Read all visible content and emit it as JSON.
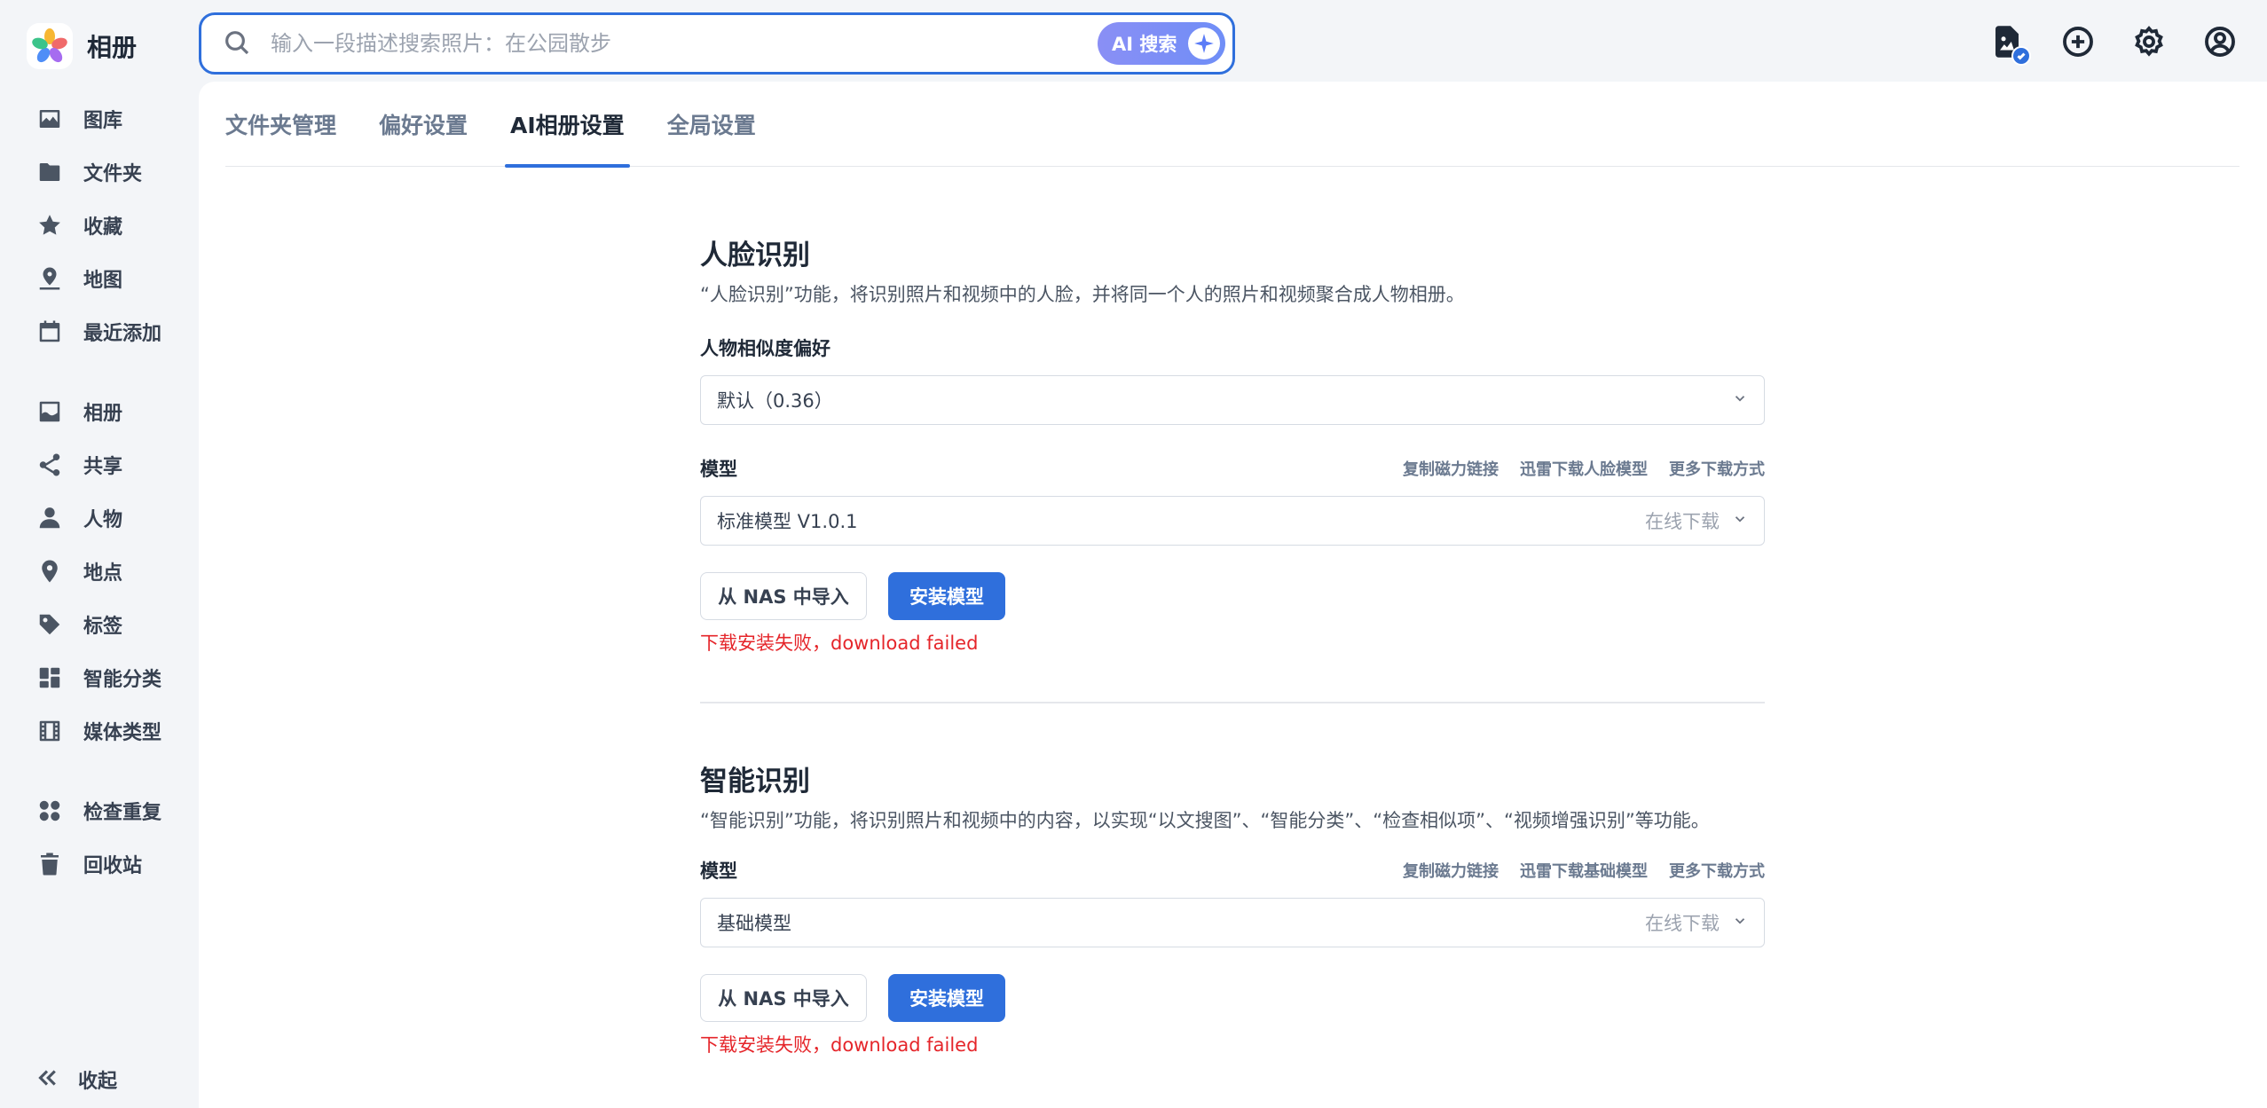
{
  "app": {
    "name": "相册"
  },
  "search": {
    "placeholder": "输入一段描述搜索照片：在公园散步",
    "ai_label": "AI 搜索"
  },
  "sidebar": {
    "group1": [
      {
        "label": "图库",
        "icon": "image-icon"
      },
      {
        "label": "文件夹",
        "icon": "folder-icon"
      },
      {
        "label": "收藏",
        "icon": "star-icon"
      },
      {
        "label": "地图",
        "icon": "map-icon"
      },
      {
        "label": "最近添加",
        "icon": "calendar-icon"
      }
    ],
    "group2": [
      {
        "label": "相册",
        "icon": "album-icon"
      },
      {
        "label": "共享",
        "icon": "share-icon"
      },
      {
        "label": "人物",
        "icon": "person-icon"
      },
      {
        "label": "地点",
        "icon": "location-icon"
      },
      {
        "label": "标签",
        "icon": "tag-icon"
      },
      {
        "label": "智能分类",
        "icon": "grid-icon"
      },
      {
        "label": "媒体类型",
        "icon": "film-icon"
      }
    ],
    "group3": [
      {
        "label": "检查重复",
        "icon": "duplicate-icon"
      },
      {
        "label": "回收站",
        "icon": "trash-icon"
      }
    ],
    "collapse_label": "收起"
  },
  "tabs": [
    {
      "label": "文件夹管理",
      "active": false
    },
    {
      "label": "偏好设置",
      "active": false
    },
    {
      "label": "AI相册设置",
      "active": true
    },
    {
      "label": "全局设置",
      "active": false
    }
  ],
  "face": {
    "title": "人脸识别",
    "desc": "“人脸识别”功能，将识别照片和视频中的人脸，并将同一个人的照片和视频聚合成人物相册。",
    "similarity_label": "人物相似度偏好",
    "similarity_value": "默认（0.36）",
    "model_label": "模型",
    "links": [
      "复制磁力链接",
      "迅雷下载人脸模型",
      "更多下载方式"
    ],
    "model_value": "标准模型 V1.0.1",
    "model_hint": "在线下载",
    "import_label": "从 NAS 中导入",
    "install_label": "安装模型",
    "error": "下载安装失败，download failed"
  },
  "smart": {
    "title": "智能识别",
    "desc": "“智能识别”功能，将识别照片和视频中的内容，以实现“以文搜图”、“智能分类”、“检查相似项”、“视频增强识别”等功能。",
    "model_label": "模型",
    "links": [
      "复制磁力链接",
      "迅雷下载基础模型",
      "更多下载方式"
    ],
    "model_value": "基础模型",
    "model_hint": "在线下载",
    "import_label": "从 NAS 中导入",
    "install_label": "安装模型",
    "error": "下载安装失败，download failed"
  },
  "colors": {
    "accent": "#2f6fdc",
    "error": "#e5252a"
  }
}
